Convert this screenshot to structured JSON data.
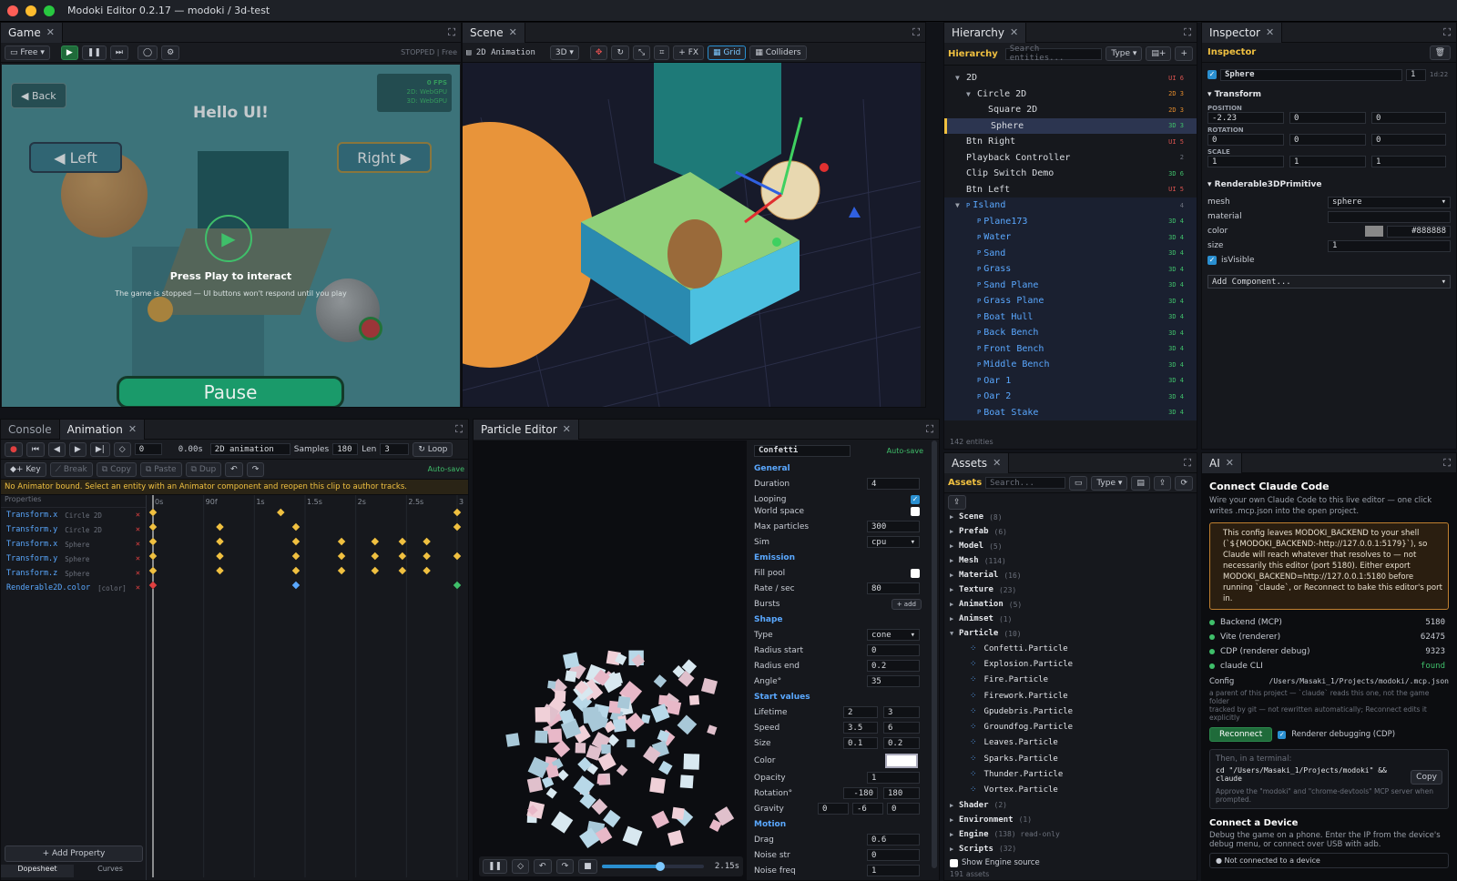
{
  "window": {
    "title": "Modoki Editor 0.2.17 — modoki / 3d-test"
  },
  "game": {
    "tab": "Game",
    "mode": "Free",
    "status": "STOPPED | Free",
    "back": "◀ Back",
    "heading": "Hello UI!",
    "fps": "0 FPS",
    "fps_2d": "2D: WebGPU",
    "fps_3d": "3D: WebGPU",
    "left_btn": "◀ Left",
    "right_btn": "Right ▶",
    "press_play": "Press Play to interact",
    "press_sub": "The game is stopped — UI buttons won't respond until you play",
    "pause": "Pause"
  },
  "scene": {
    "tab": "Scene",
    "anim_label": "2D Animation",
    "mode": "3D",
    "fx": "+ FX",
    "grid": "Grid",
    "colliders": "Colliders"
  },
  "hierarchy": {
    "tab": "Hierarchy",
    "title": "Hierarchy",
    "search_placeholder": "Search entities...",
    "type": "Type",
    "count": "142 entities",
    "items": [
      {
        "label": "2D",
        "badge": "UI 6",
        "indent": 0,
        "arrow": "▼",
        "kind": "ui"
      },
      {
        "label": "Circle 2D",
        "badge": "2D 3",
        "indent": 1,
        "arrow": "▼",
        "kind": "d2"
      },
      {
        "label": "Square 2D",
        "badge": "2D 3",
        "indent": 2,
        "arrow": "",
        "kind": "d2"
      },
      {
        "label": "Sphere",
        "badge": "3D 3",
        "indent": 2,
        "arrow": "",
        "kind": "d3",
        "selected": true
      },
      {
        "label": "Btn Right",
        "badge": "UI 5",
        "indent": 0,
        "arrow": "",
        "kind": "ui"
      },
      {
        "label": "Playback Controller",
        "badge": "2",
        "indent": 0,
        "arrow": "",
        "kind": "plain"
      },
      {
        "label": "Clip Switch Demo",
        "badge": "3D 6",
        "indent": 0,
        "arrow": "",
        "kind": "d3"
      },
      {
        "label": "Btn Left",
        "badge": "UI 5",
        "indent": 0,
        "arrow": "",
        "kind": "ui"
      },
      {
        "label": "Island",
        "badge": "4",
        "indent": 0,
        "arrow": "▼",
        "kind": "prefab"
      },
      {
        "label": "Plane173",
        "badge": "3D 4",
        "indent": 1,
        "arrow": "",
        "kind": "prefab"
      },
      {
        "label": "Water",
        "badge": "3D 4",
        "indent": 1,
        "arrow": "",
        "kind": "prefab"
      },
      {
        "label": "Sand",
        "badge": "3D 4",
        "indent": 1,
        "arrow": "",
        "kind": "prefab"
      },
      {
        "label": "Grass",
        "badge": "3D 4",
        "indent": 1,
        "arrow": "",
        "kind": "prefab"
      },
      {
        "label": "Sand Plane",
        "badge": "3D 4",
        "indent": 1,
        "arrow": "",
        "kind": "prefab"
      },
      {
        "label": "Grass Plane",
        "badge": "3D 4",
        "indent": 1,
        "arrow": "",
        "kind": "prefab"
      },
      {
        "label": "Boat Hull",
        "badge": "3D 4",
        "indent": 1,
        "arrow": "",
        "kind": "prefab"
      },
      {
        "label": "Back Bench",
        "badge": "3D 4",
        "indent": 1,
        "arrow": "",
        "kind": "prefab"
      },
      {
        "label": "Front Bench",
        "badge": "3D 4",
        "indent": 1,
        "arrow": "",
        "kind": "prefab"
      },
      {
        "label": "Middle Bench",
        "badge": "3D 4",
        "indent": 1,
        "arrow": "",
        "kind": "prefab"
      },
      {
        "label": "Oar 1",
        "badge": "3D 4",
        "indent": 1,
        "arrow": "",
        "kind": "prefab"
      },
      {
        "label": "Oar 2",
        "badge": "3D 4",
        "indent": 1,
        "arrow": "",
        "kind": "prefab"
      },
      {
        "label": "Boat Stake",
        "badge": "3D 4",
        "indent": 1,
        "arrow": "",
        "kind": "prefab"
      }
    ]
  },
  "inspector": {
    "tab": "Inspector",
    "title": "Inspector",
    "entity": "Sphere",
    "entity_n": "1",
    "entity_id": "1d:22",
    "transform": "Transform",
    "position": "POSITION",
    "pos": [
      "-2.23",
      "0",
      "0"
    ],
    "rotation": "ROTATION",
    "rot": [
      "0",
      "0",
      "0"
    ],
    "scale": "SCALE",
    "scl": [
      "1",
      "1",
      "1"
    ],
    "renderable": "Renderable3DPrimitive",
    "mesh_l": "mesh",
    "mesh_v": "sphere",
    "material_l": "material",
    "color_l": "color",
    "color_v": "#888888",
    "size_l": "size",
    "size_v": "1",
    "visible_l": "isVisible",
    "add_component": "Add Component..."
  },
  "console_tab": "Console",
  "animation": {
    "tab": "Animation",
    "frame": "0",
    "time": "0.00s",
    "clip": "2D animation",
    "samples_l": "Samples",
    "samples": "180",
    "len_l": "Len",
    "len": "3",
    "loop": "Loop",
    "key": "Key",
    "break": "Break",
    "copy": "Copy",
    "paste": "Paste",
    "dup": "Dup",
    "autosave": "Auto-save",
    "warning": "No Animator bound. Select an entity with an Animator component and reopen this clip to author tracks.",
    "props_header": "Properties",
    "ticks": [
      "0s",
      "90f",
      "1s",
      "1.5s",
      "2s",
      "2.5s",
      "3"
    ],
    "tracks": [
      {
        "prop": "Transform.x",
        "target": "Circle 2D"
      },
      {
        "prop": "Transform.y",
        "target": "Circle 2D"
      },
      {
        "prop": "Transform.x",
        "target": "Sphere"
      },
      {
        "prop": "Transform.y",
        "target": "Sphere"
      },
      {
        "prop": "Transform.z",
        "target": "Sphere"
      },
      {
        "prop": "Renderable2D.color",
        "target": "[color]"
      }
    ],
    "add_property": "+ Add Property",
    "dopesheet": "Dopesheet",
    "curves": "Curves"
  },
  "particle": {
    "tab": "Particle Editor",
    "name": "Confetti",
    "autosave": "Auto-save",
    "time": "2.15s",
    "general": "General",
    "duration_l": "Duration",
    "duration": "4",
    "looping_l": "Looping",
    "worldspace_l": "World space",
    "maxp_l": "Max particles",
    "maxp": "300",
    "sim_l": "Sim",
    "sim": "cpu",
    "emission": "Emission",
    "fillpool_l": "Fill pool",
    "rate_l": "Rate / sec",
    "rate": "80",
    "bursts_l": "Bursts",
    "add": "+ add",
    "shape": "Shape",
    "type_l": "Type",
    "type": "cone",
    "rstart_l": "Radius start",
    "rstart": "0",
    "rend_l": "Radius end",
    "rend": "0.2",
    "angle_l": "Angle°",
    "angle": "35",
    "start": "Start values",
    "life_l": "Lifetime",
    "life": [
      "2",
      "3"
    ],
    "speed_l": "Speed",
    "speed": [
      "3.5",
      "6"
    ],
    "size_l": "Size",
    "size": [
      "0.1",
      "0.2"
    ],
    "color_l": "Color",
    "opacity_l": "Opacity",
    "opacity": "1",
    "rot_l": "Rotation°",
    "rot": [
      "-180",
      "180"
    ],
    "grav_l": "Gravity",
    "grav": [
      "0",
      "-6",
      "0"
    ],
    "motion": "Motion",
    "drag_l": "Drag",
    "drag": "0.6",
    "nstr_l": "Noise str",
    "nstr": "0",
    "nfreq_l": "Noise freq",
    "nfreq": "1"
  },
  "assets": {
    "tab": "Assets",
    "title": "Assets",
    "search_placeholder": "Search...",
    "type": "Type",
    "count": "191 assets",
    "show_engine": "Show Engine source",
    "folders_top": [
      {
        "n": "Scene",
        "c": "(8)"
      },
      {
        "n": "Prefab",
        "c": "(6)"
      },
      {
        "n": "Model",
        "c": "(5)"
      },
      {
        "n": "Mesh",
        "c": "(114)"
      },
      {
        "n": "Material",
        "c": "(16)"
      },
      {
        "n": "Texture",
        "c": "(23)"
      },
      {
        "n": "Animation",
        "c": "(5)"
      },
      {
        "n": "Animset",
        "c": "(1)"
      },
      {
        "n": "Particle",
        "c": "(10)"
      }
    ],
    "particles": [
      "Confetti.Particle",
      "Explosion.Particle",
      "Fire.Particle",
      "Firework.Particle",
      "Gpudebris.Particle",
      "Groundfog.Particle",
      "Leaves.Particle",
      "Sparks.Particle",
      "Thunder.Particle",
      "Vortex.Particle"
    ],
    "folders_bottom": [
      {
        "n": "Shader",
        "c": "(2)"
      },
      {
        "n": "Environment",
        "c": "(1)"
      },
      {
        "n": "Engine",
        "c": "(138) read-only"
      },
      {
        "n": "Scripts",
        "c": "(32)"
      }
    ]
  },
  "ai": {
    "tab": "AI",
    "heading": "Connect Claude Code",
    "intro": "Wire your own Claude Code to this live editor — one click writes .mcp.json into the open project.",
    "warn": "This config leaves MODOKI_BACKEND to your shell (`${MODOKI_BACKEND:-http://127.0.0.1:5179}`), so Claude will reach whatever that resolves to — not necessarily this editor (port 5180). Either export MODOKI_BACKEND=http://127.0.0.1:5180 before running `claude`, or Reconnect to bake this editor's port in.",
    "status": [
      {
        "l": "Backend (MCP)",
        "v": "5180"
      },
      {
        "l": "Vite (renderer)",
        "v": "62475"
      },
      {
        "l": "CDP (renderer debug)",
        "v": "9323"
      },
      {
        "l": "claude CLI",
        "v": "found"
      }
    ],
    "config_l": "Config",
    "config_v": "/Users/Masaki_1/Projects/modoki/.mcp.json",
    "config_note1": "a parent of this project — `claude` reads this one, not the game folder",
    "config_note2": "tracked by git — not rewritten automatically; Reconnect edits it explicitly",
    "reconnect": "Reconnect",
    "cdp": "Renderer debugging (CDP)",
    "then": "Then, in a terminal:",
    "cmd": "cd \"/Users/Masaki_1/Projects/modoki\" && claude",
    "copy": "Copy",
    "approve": "Approve the \"modoki\" and \"chrome-devtools\" MCP server when prompted.",
    "device_h": "Connect a Device",
    "device_p": "Debug the game on a phone. Enter the IP from the device's debug menu, or connect over USB with adb.",
    "device_status": "Not connected to a device"
  },
  "colors": {
    "accent": "#f0c040",
    "green": "#3fbf6a",
    "red": "#d9534f",
    "blue": "#5aa8ff"
  }
}
